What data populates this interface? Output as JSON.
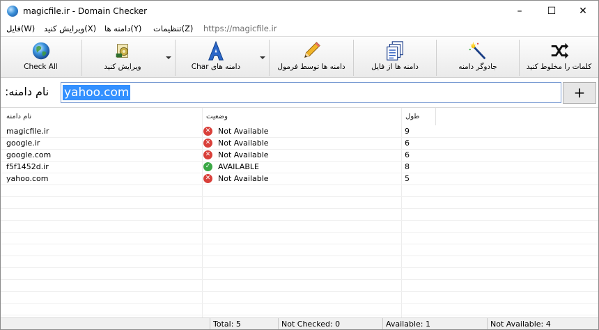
{
  "window": {
    "title": "magicfile.ir - Domain Checker",
    "controls": {
      "minimize": "–",
      "maximize": "☐",
      "close": "✕"
    }
  },
  "menu": {
    "items": [
      "فایل(W)",
      "ویرایش کنید(X)",
      "دامنه ها(Y)",
      "تنظیمات(Z)"
    ],
    "url": "https://magicfile.ir"
  },
  "toolbar": {
    "buttons": [
      {
        "label": "Check All",
        "icon": "globe-icon"
      },
      {
        "label": "ویرایش کنید",
        "icon": "edit-gear-icon"
      },
      {
        "label": "Char دامنه های",
        "icon": "letter-a-icon"
      },
      {
        "label": "دامنه ها توسط فرمول",
        "icon": "pencil-icon"
      },
      {
        "label": "دامنه ها از فایل",
        "icon": "documents-icon"
      },
      {
        "label": "جادوگر دامنه",
        "icon": "magic-wand-icon"
      },
      {
        "label": "کلمات را مخلوط کنید",
        "icon": "shuffle-icon"
      }
    ]
  },
  "domain_input": {
    "label": ":نام دامنه",
    "value": "yahoo.com",
    "add_label": "+"
  },
  "table": {
    "columns": [
      "نام دامنه",
      "وضعیت",
      "طول"
    ],
    "rows": [
      {
        "domain": "magicfile.ir",
        "status": "Not Available",
        "available": false,
        "length": "9"
      },
      {
        "domain": "google.ir",
        "status": "Not Available",
        "available": false,
        "length": "6"
      },
      {
        "domain": "google.com",
        "status": "Not Available",
        "available": false,
        "length": "6"
      },
      {
        "domain": "f5f1452d.ir",
        "status": "AVAILABLE",
        "available": true,
        "length": "8"
      },
      {
        "domain": "yahoo.com",
        "status": "Not Available",
        "available": false,
        "length": "5"
      }
    ]
  },
  "statusbar": {
    "total": "Total: 5",
    "not_checked": "Not Checked: 0",
    "available": "Available: 1",
    "not_available": "Not Available: 4"
  },
  "colors": {
    "unavailable": "#d9403a",
    "available": "#3aa845",
    "selection": "#3390ff"
  }
}
